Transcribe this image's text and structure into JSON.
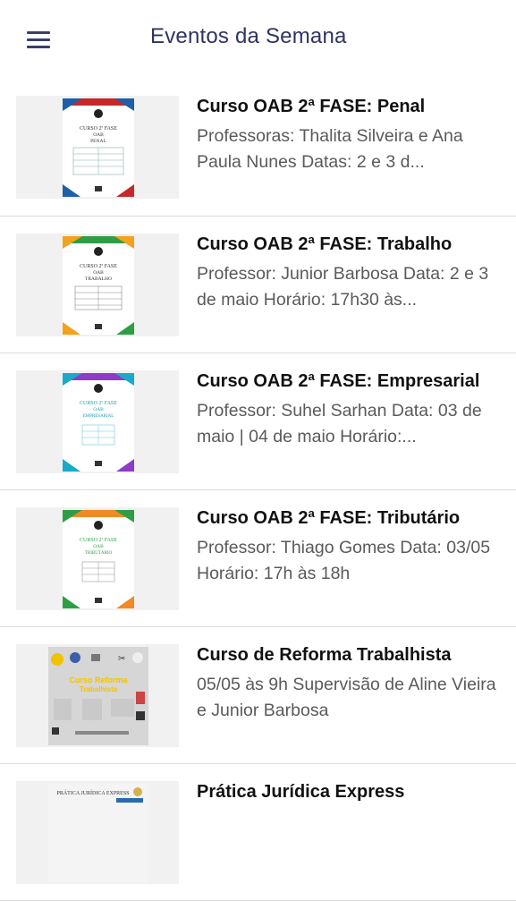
{
  "header": {
    "title": "Eventos da Semana"
  },
  "colors": {
    "header_title": "#2f3461",
    "penal_accent": "#c62828",
    "trabalho_accent": "#2e9e45",
    "empresarial_accent": "#8e3bc9",
    "tributario_accent": "#2e9e45"
  },
  "events": [
    {
      "title": "Curso OAB 2ª FASE: Penal",
      "description": "Professoras: Thalita Silveira e Ana Paula Nunes Datas: 2 e 3 d...",
      "poster": {
        "heading": "CURSO 2ª FASE",
        "sub": "OAB",
        "subject": "PENAL"
      }
    },
    {
      "title": "Curso OAB 2ª FASE: Trabalho",
      "description": "Professor: Junior Barbosa Data: 2 e 3 de maio Horário: 17h30 às...",
      "poster": {
        "heading": "CURSO 2ª FASE",
        "sub": "OAB",
        "subject": "TRABALHO"
      }
    },
    {
      "title": "Curso OAB 2ª FASE: Empresarial",
      "description": "Professor: Suhel Sarhan Data: 03 de maio | 04 de maio Horário:...",
      "poster": {
        "heading": "CURSO 2ª FASE",
        "sub": "OAB",
        "subject": "EMPRESARIAL"
      }
    },
    {
      "title": "Curso OAB 2ª FASE: Tributário",
      "description": "Professor: Thiago Gomes Data: 03/05 Horário: 17h às 18h",
      "poster": {
        "heading": "CURSO 2ª FASE",
        "sub": "OAB",
        "subject": "TRIBUTÁRIO"
      }
    },
    {
      "title": "Curso de Reforma Trabalhista",
      "description": "05/05 às 9h Supervisão de Aline Vieira e Junior Barbosa",
      "poster": {
        "heading": "Curso Reforma",
        "sub": "Trabalhista"
      }
    },
    {
      "title": "Prática Jurídica Express",
      "description": "",
      "poster": {
        "heading": "PRÁTICA JURÍDICA EXPRESS"
      }
    }
  ]
}
